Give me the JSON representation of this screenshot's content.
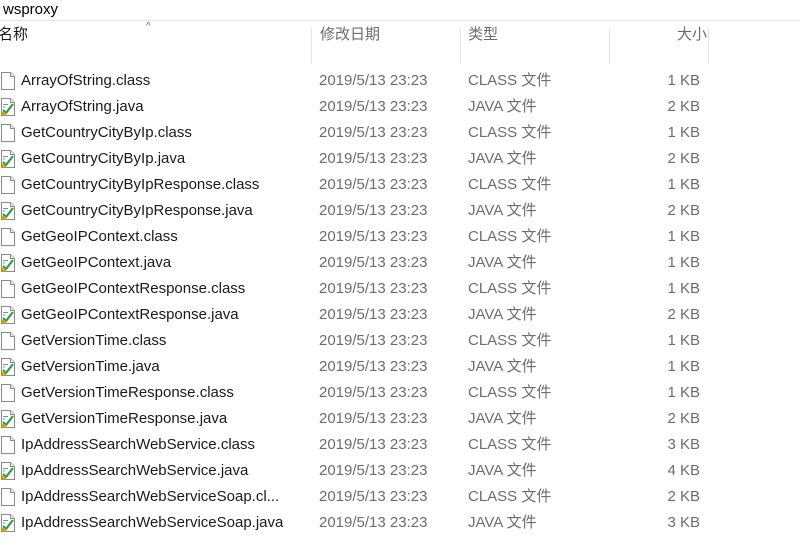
{
  "window": {
    "title": "wsproxy"
  },
  "header": {
    "col_name": "名称",
    "col_date": "修改日期",
    "col_type": "类型",
    "col_size": "大小",
    "sort_indicator": "^"
  },
  "icons": {
    "class": "file-icon",
    "java": "java-file-icon"
  },
  "files": [
    {
      "name": "ArrayOfString.class",
      "date": "2019/5/13 23:23",
      "type": "CLASS 文件",
      "size": "1 KB",
      "kind": "class"
    },
    {
      "name": "ArrayOfString.java",
      "date": "2019/5/13 23:23",
      "type": "JAVA 文件",
      "size": "2 KB",
      "kind": "java"
    },
    {
      "name": "GetCountryCityByIp.class",
      "date": "2019/5/13 23:23",
      "type": "CLASS 文件",
      "size": "1 KB",
      "kind": "class"
    },
    {
      "name": "GetCountryCityByIp.java",
      "date": "2019/5/13 23:23",
      "type": "JAVA 文件",
      "size": "2 KB",
      "kind": "java"
    },
    {
      "name": "GetCountryCityByIpResponse.class",
      "date": "2019/5/13 23:23",
      "type": "CLASS 文件",
      "size": "1 KB",
      "kind": "class"
    },
    {
      "name": "GetCountryCityByIpResponse.java",
      "date": "2019/5/13 23:23",
      "type": "JAVA 文件",
      "size": "2 KB",
      "kind": "java"
    },
    {
      "name": "GetGeoIPContext.class",
      "date": "2019/5/13 23:23",
      "type": "CLASS 文件",
      "size": "1 KB",
      "kind": "class"
    },
    {
      "name": "GetGeoIPContext.java",
      "date": "2019/5/13 23:23",
      "type": "JAVA 文件",
      "size": "1 KB",
      "kind": "java"
    },
    {
      "name": "GetGeoIPContextResponse.class",
      "date": "2019/5/13 23:23",
      "type": "CLASS 文件",
      "size": "1 KB",
      "kind": "class"
    },
    {
      "name": "GetGeoIPContextResponse.java",
      "date": "2019/5/13 23:23",
      "type": "JAVA 文件",
      "size": "2 KB",
      "kind": "java"
    },
    {
      "name": "GetVersionTime.class",
      "date": "2019/5/13 23:23",
      "type": "CLASS 文件",
      "size": "1 KB",
      "kind": "class"
    },
    {
      "name": "GetVersionTime.java",
      "date": "2019/5/13 23:23",
      "type": "JAVA 文件",
      "size": "1 KB",
      "kind": "java"
    },
    {
      "name": "GetVersionTimeResponse.class",
      "date": "2019/5/13 23:23",
      "type": "CLASS 文件",
      "size": "1 KB",
      "kind": "class"
    },
    {
      "name": "GetVersionTimeResponse.java",
      "date": "2019/5/13 23:23",
      "type": "JAVA 文件",
      "size": "2 KB",
      "kind": "java"
    },
    {
      "name": "IpAddressSearchWebService.class",
      "date": "2019/5/13 23:23",
      "type": "CLASS 文件",
      "size": "3 KB",
      "kind": "class"
    },
    {
      "name": "IpAddressSearchWebService.java",
      "date": "2019/5/13 23:23",
      "type": "JAVA 文件",
      "size": "4 KB",
      "kind": "java"
    },
    {
      "name": "IpAddressSearchWebServiceSoap.cl...",
      "date": "2019/5/13 23:23",
      "type": "CLASS 文件",
      "size": "2 KB",
      "kind": "class"
    },
    {
      "name": "IpAddressSearchWebServiceSoap.java",
      "date": "2019/5/13 23:23",
      "type": "JAVA 文件",
      "size": "3 KB",
      "kind": "java"
    }
  ]
}
